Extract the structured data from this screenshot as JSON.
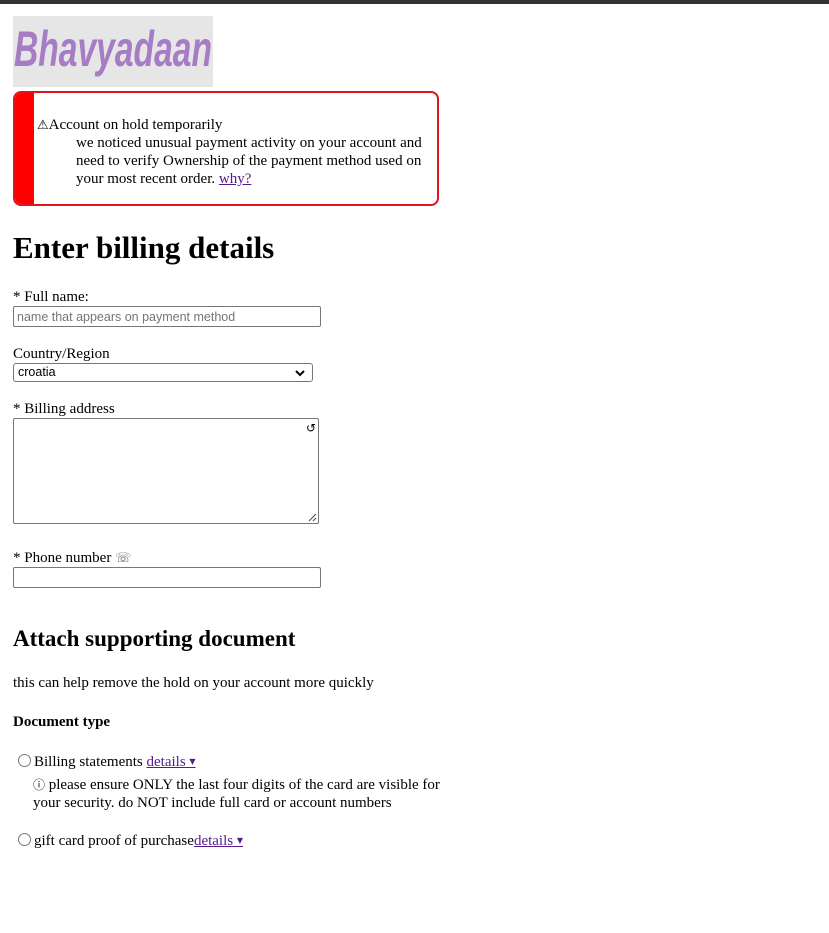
{
  "logo": {
    "text": "Bhavyadaan",
    "color": "#a67cc4",
    "background": "#e6e6e6"
  },
  "alert": {
    "icon": "warning-icon",
    "icon_glyph": "⚠",
    "title": "Account on hold temporarily",
    "body": "we noticed unusual payment activity on your account and need to verify Ownership of the payment method used on your most recent order.",
    "link": "why?",
    "border_color": "#e0141a",
    "stripe_color": "#ff0000"
  },
  "page": {
    "title": "Enter billing details"
  },
  "form": {
    "full_name": {
      "label": "* Full name:",
      "value": "",
      "placeholder": "name that appears on payment method"
    },
    "country": {
      "label": "Country/Region",
      "selected": "croatia"
    },
    "billing_address": {
      "label": "* Billing address",
      "value": "",
      "icon": "refresh-icon",
      "icon_glyph": "↺"
    },
    "phone": {
      "label": "* Phone number",
      "icon": "telephone-icon",
      "icon_glyph": "☏",
      "value": ""
    }
  },
  "attach": {
    "title": "Attach supporting document",
    "description": "this can help remove the hold on your account more quickly",
    "doc_type_label": "Document type",
    "options": [
      {
        "label": "Billing statements",
        "details_link": "details",
        "note_icon": "info-icon",
        "note_icon_glyph": "ⓘ",
        "note": "please ensure ONLY the last four digits of the card are visible for your security. do NOT include full card or account numbers"
      },
      {
        "label": "gift card proof of purchase",
        "details_link": "details"
      }
    ],
    "dropdown_glyph": "▼"
  },
  "colors": {
    "link": "#551a8b",
    "topbar": "#333333"
  }
}
